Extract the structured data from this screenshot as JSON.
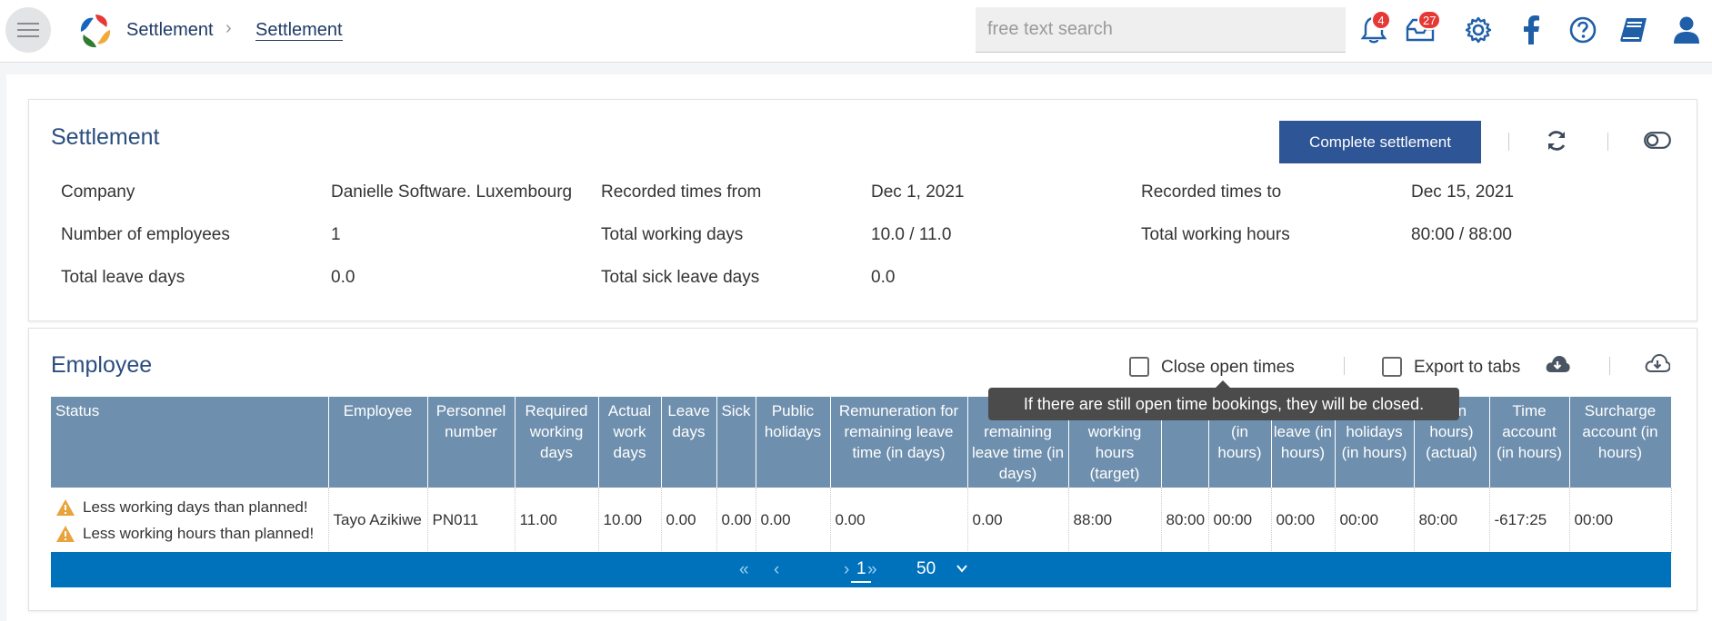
{
  "header": {
    "breadcrumb": [
      "Settlement",
      "Settlement"
    ],
    "search_placeholder": "free text search",
    "notifications_count": "4",
    "inbox_count": "27",
    "icons": [
      "menu-icon",
      "bell-icon",
      "inbox-icon",
      "gear-icon",
      "facebook-icon",
      "help-icon",
      "book-icon",
      "user-icon"
    ]
  },
  "settlement": {
    "title": "Settlement",
    "complete_button": "Complete settlement",
    "fields": [
      {
        "label": "Company",
        "value": "Danielle Software. Luxembourg"
      },
      {
        "label": "Recorded times from",
        "value": "Dec 1, 2021"
      },
      {
        "label": "Recorded times to",
        "value": "Dec 15, 2021"
      },
      {
        "label": "Number of employees",
        "value": "1"
      },
      {
        "label": "Total working days",
        "value": "10.0 / 11.0"
      },
      {
        "label": "Total working hours",
        "value": "80:00 / 88:00"
      },
      {
        "label": "Total leave days",
        "value": "0.0"
      },
      {
        "label": "Total sick leave days",
        "value": "0.0"
      }
    ]
  },
  "employee": {
    "title": "Employee",
    "close_open_times": "Close open times",
    "export_to_tabs": "Export to tabs",
    "tooltip": "If there are still open time bookings, they will be closed.",
    "columns": [
      "Status",
      "Employee",
      "Personnel number",
      "Required working days",
      "Actual work days",
      "Leave days",
      "Sick",
      "Public holidays",
      "Remuneration for remaining leave time (in days)",
      "remaining leave time (in days)",
      "working hours (target)",
      "",
      "(in hours)",
      "leave (in hours)",
      "holidays (in hours)",
      "n (in hours) (actual)",
      "Time account (in hours)",
      "Surcharge account (in hours)"
    ],
    "rows": [
      {
        "status": [
          "Less working days than planned!",
          "Less working hours than planned!"
        ],
        "cells": [
          "Tayo Azikiwe",
          "PN011",
          "11.00",
          "10.00",
          "0.00",
          "0.00",
          "0.00",
          "0.00",
          "0.00",
          "88:00",
          "80:00",
          "00:00",
          "00:00",
          "00:00",
          "80:00",
          "-617:25",
          "00:00"
        ]
      }
    ]
  },
  "pager": {
    "current_page": "1",
    "page_size": "50"
  },
  "colors": {
    "primary": "#2e5596",
    "table_header": "#6e8fad",
    "pager": "#0072bc",
    "badge": "#e53935",
    "warning": "#e8a33d"
  }
}
